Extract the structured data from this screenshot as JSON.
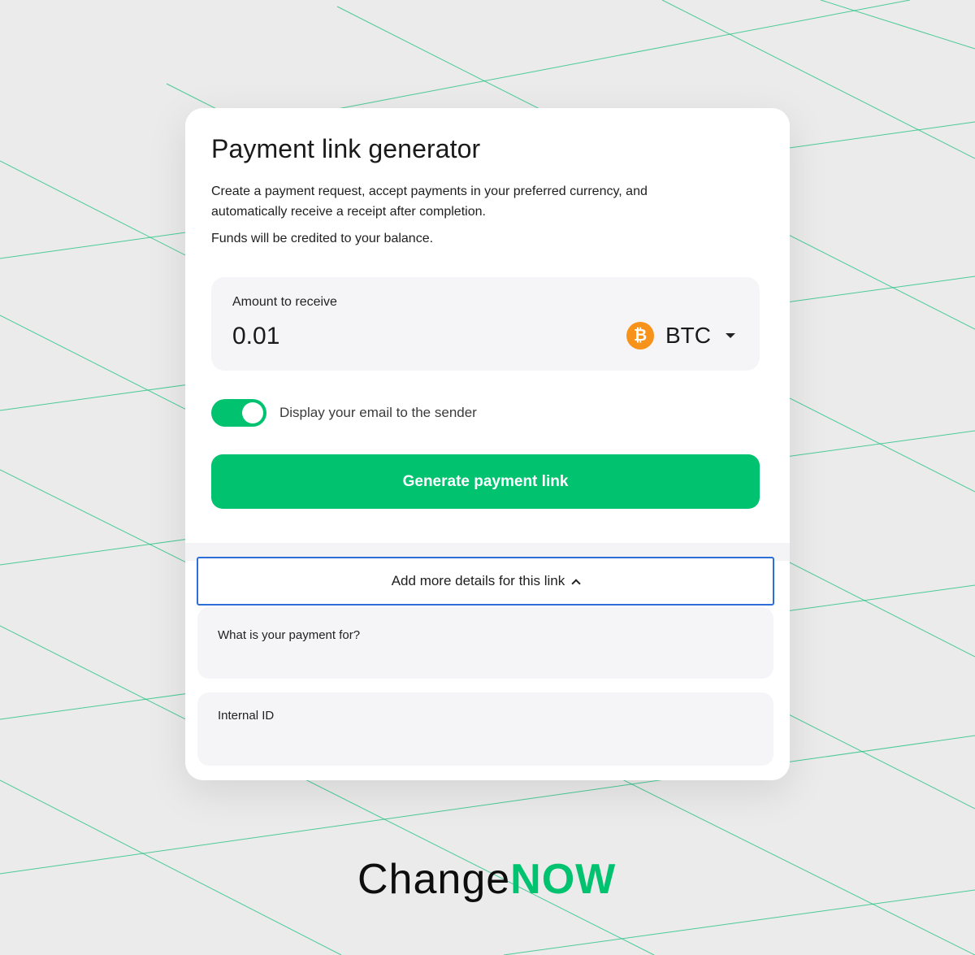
{
  "card": {
    "title": "Payment link generator",
    "description": "Create a payment request, accept payments in your preferred currency, and automatically receive a receipt after completion.",
    "note": "Funds will be credited to your balance.",
    "amount": {
      "label": "Amount to receive",
      "value": "0.01",
      "currency_code": "BTC",
      "currency_icon": "bitcoin-icon",
      "currency_icon_symbol": "₿",
      "currency_icon_color": "#f7931a"
    },
    "email_toggle": {
      "label": "Display your email to the sender",
      "on": true
    },
    "generate_button": "Generate payment link",
    "details_toggle": "Add more details for this link",
    "fields": {
      "payment_for": "What is your payment for?",
      "internal_id": "Internal ID"
    }
  },
  "brand": {
    "part1": "Change",
    "part2": "NOW"
  },
  "colors": {
    "accent": "#00c26f",
    "focus": "#2d6fd6",
    "background": "#ebebeb"
  }
}
